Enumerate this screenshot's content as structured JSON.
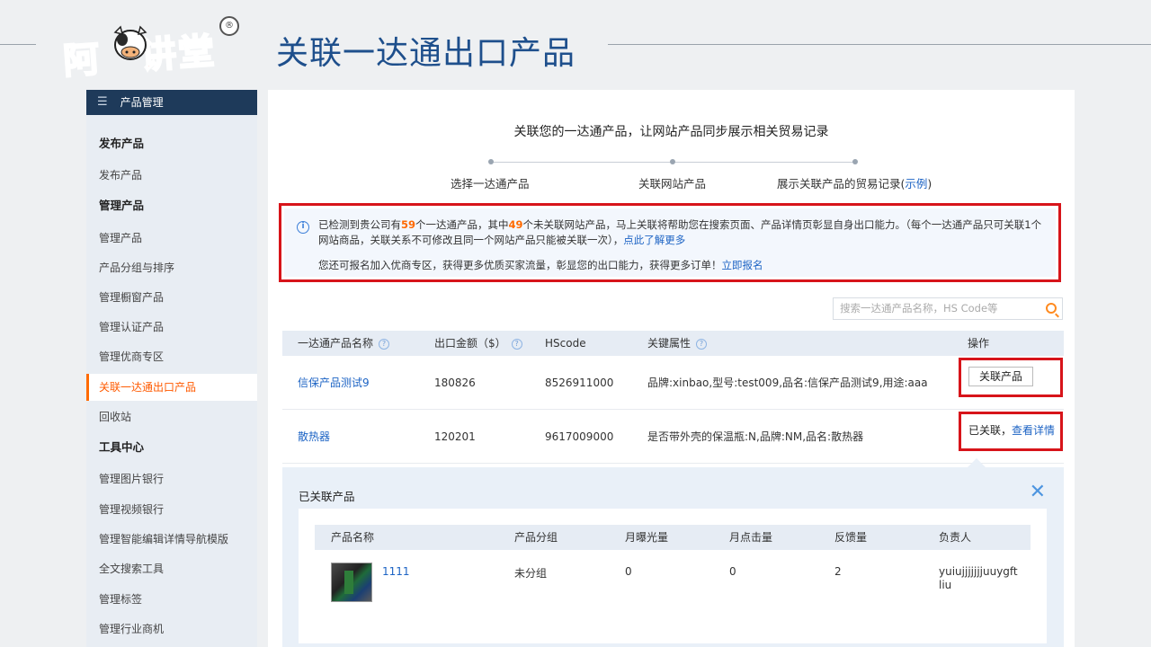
{
  "slide": {
    "logo_text_a": "阿",
    "logo_text_b": "讲堂",
    "logo_badge": "®",
    "title": "关联一达通出口产品"
  },
  "sidebar": {
    "header": "产品管理",
    "header_icon": "menu-icon",
    "items": [
      {
        "label": "发布产品",
        "type": "group"
      },
      {
        "label": "发布产品",
        "type": "item"
      },
      {
        "label": "管理产品",
        "type": "group"
      },
      {
        "label": "管理产品",
        "type": "item"
      },
      {
        "label": "产品分组与排序",
        "type": "item"
      },
      {
        "label": "管理橱窗产品",
        "type": "item"
      },
      {
        "label": "管理认证产品",
        "type": "item"
      },
      {
        "label": "管理优商专区",
        "type": "item"
      },
      {
        "label": "关联一达通出口产品",
        "type": "active"
      },
      {
        "label": "回收站",
        "type": "item"
      },
      {
        "label": "工具中心",
        "type": "group"
      },
      {
        "label": "管理图片银行",
        "type": "item"
      },
      {
        "label": "管理视频银行",
        "type": "item"
      },
      {
        "label": "管理智能编辑详情导航模版",
        "type": "item"
      },
      {
        "label": "全文搜索工具",
        "type": "item"
      },
      {
        "label": "管理标签",
        "type": "item"
      },
      {
        "label": "管理行业商机",
        "type": "item"
      }
    ]
  },
  "main": {
    "intro": "关联您的一达通产品，让网站产品同步展示相关贸易记录",
    "steps": {
      "step1": "选择一达通产品",
      "step2": "关联网站产品",
      "step3_prefix": "展示关联产品的贸易记录(",
      "step3_link": "示例",
      "step3_suffix": ")"
    },
    "notice": {
      "p1": "已检测到贵公司有",
      "count1": "59",
      "p2": "个一达通产品，其中",
      "count2": "49",
      "p3": "个未关联网站产品，马上关联将帮助您在搜索页面、产品详情页彰显自身出口能力。（每个一达通产品只可关联1个网站商品，关联关系不可修改且同一个网站产品只能被关联一次），",
      "link1": "点此了解更多",
      "line2": "您还可报名加入优商专区，获得更多优质买家流量，彰显您的出口能力，获得更多订单！",
      "link2": "立即报名"
    },
    "search": {
      "placeholder": "搜索一达通产品名称，HS Code等"
    },
    "table": {
      "headers": {
        "name": "一达通产品名称",
        "amount": "出口金额（$）",
        "hscode": "HScode",
        "attrs": "关键属性",
        "ops": "操作"
      },
      "rows": [
        {
          "name": "信保产品测试9",
          "amount": "180826",
          "hscode": "8526911000",
          "attrs": "品牌:xinbao,型号:test009,品名:信保产品测试9,用途:aaa",
          "op_button": "关联产品"
        },
        {
          "name": "散热器",
          "amount": "120201",
          "hscode": "9617009000",
          "attrs": "是否带外壳的保温瓶:N,品牌:NM,品名:散热器",
          "op_status": "已关联，",
          "op_link": "查看详情"
        }
      ]
    },
    "related": {
      "title": "已关联产品",
      "headers": {
        "name": "产品名称",
        "group": "产品分组",
        "exposure": "月曝光量",
        "clicks": "月点击量",
        "feedback": "反馈量",
        "owner": "负责人"
      },
      "rows": [
        {
          "name": "1111",
          "group": "未分组",
          "exposure": "0",
          "clicks": "0",
          "feedback": "2",
          "owner": "yuiujjjjjjjuuygft liu"
        }
      ]
    }
  },
  "colors": {
    "accent_orange": "#ff6a00",
    "link_blue": "#1c63c4",
    "highlight_red": "#d7141a",
    "title_blue": "#1e4f8c",
    "sidebar_header": "#1e3a5a"
  }
}
